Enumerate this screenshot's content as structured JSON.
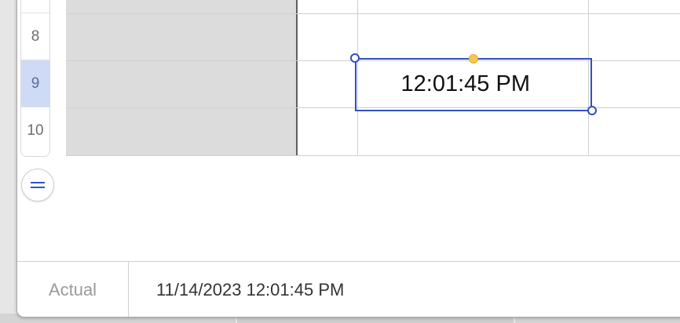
{
  "rows": [
    {
      "number": "8"
    },
    {
      "number": "9",
      "selected": true
    },
    {
      "number": "10"
    }
  ],
  "cell": {
    "value": "12:01:45 PM"
  },
  "footer": {
    "label": "Actual",
    "value": "11/14/2023 12:01:45 PM"
  },
  "colors": {
    "selection": "#2f4fc2",
    "selected_row": "#cfdaf6",
    "handle_top": "#f6c84a"
  }
}
